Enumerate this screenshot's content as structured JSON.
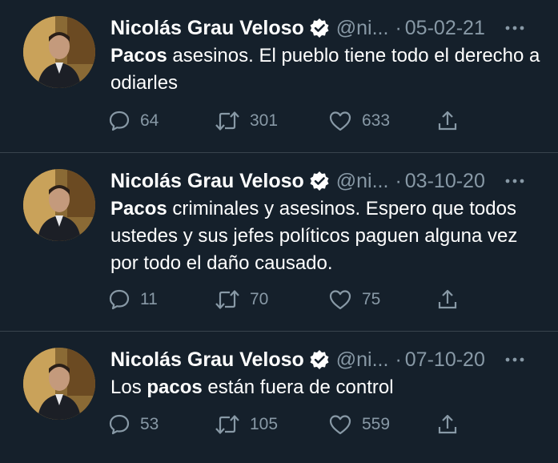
{
  "colors": {
    "background": "#15202b",
    "divider": "#38444d",
    "primary_text": "#ffffff",
    "secondary_text": "#8899a6"
  },
  "icons": {
    "verified": "verified-badge-icon",
    "more": "more-horizontal-icon",
    "reply": "reply-bubble-icon",
    "retweet": "retweet-icon",
    "like": "heart-icon",
    "share": "share-upload-icon"
  },
  "tweets": [
    {
      "author_name": "Nicolás Grau Veloso",
      "handle": "@ni...",
      "separator": "·",
      "date": "05-02-21",
      "text_parts": [
        {
          "text": "Pacos",
          "bold": true
        },
        {
          "text": " asesinos. El pueblo tiene todo el derecho a odiarles",
          "bold": false
        }
      ],
      "replies": "64",
      "retweets": "301",
      "likes": "633"
    },
    {
      "author_name": "Nicolás Grau Veloso",
      "handle": "@ni...",
      "separator": "·",
      "date": "03-10-20",
      "text_parts": [
        {
          "text": "Pacos",
          "bold": true
        },
        {
          "text": " criminales y asesinos. Espero que todos ustedes y sus jefes políticos paguen alguna vez por todo el daño causado.",
          "bold": false
        }
      ],
      "replies": "11",
      "retweets": "70",
      "likes": "75"
    },
    {
      "author_name": "Nicolás Grau Veloso",
      "handle": "@ni...",
      "separator": "·",
      "date": "07-10-20",
      "text_parts": [
        {
          "text": "Los ",
          "bold": false
        },
        {
          "text": "pacos",
          "bold": true
        },
        {
          "text": " están fuera de control",
          "bold": false
        }
      ],
      "replies": "53",
      "retweets": "105",
      "likes": "559"
    }
  ]
}
